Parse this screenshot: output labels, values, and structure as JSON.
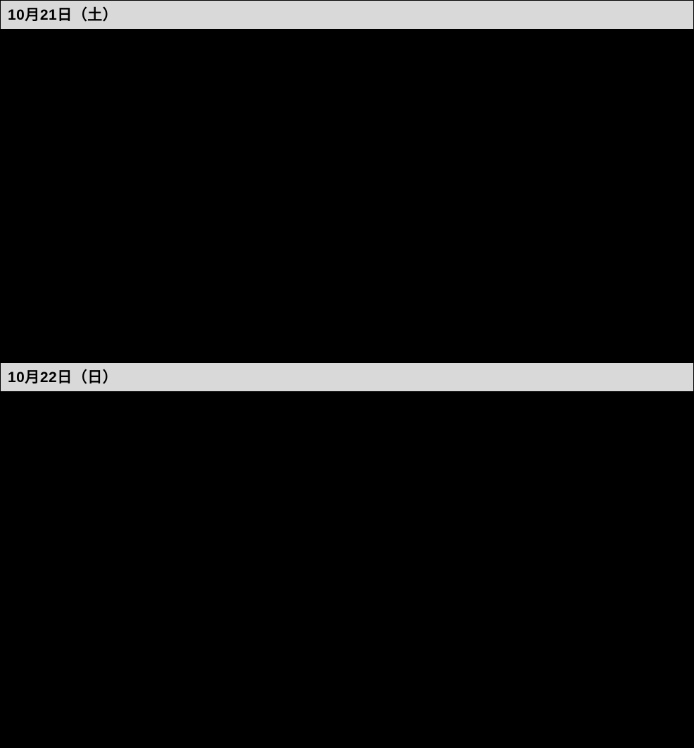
{
  "sections": [
    {
      "date_label": "10月21日（土）"
    },
    {
      "date_label": "10月22日（日）"
    }
  ]
}
